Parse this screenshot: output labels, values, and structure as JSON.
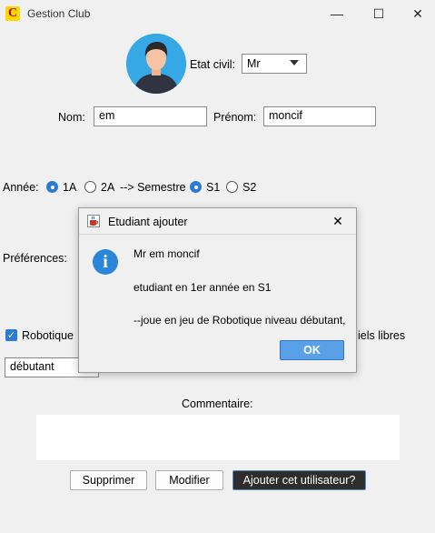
{
  "window": {
    "title": "Gestion Club",
    "app_icon_letter": "C",
    "minimize_glyph": "—",
    "maximize_glyph": "☐",
    "close_glyph": "✕"
  },
  "form": {
    "etat_civil_label": "Etat civil:",
    "etat_civil_value": "Mr",
    "nom_label": "Nom:",
    "nom_value": "em",
    "prenom_label": "Prénom:",
    "prenom_value": "moncif",
    "annee_label": "Année:",
    "annee_options": [
      "1A",
      "2A"
    ],
    "semestre_label": "--> Semestre",
    "semestre_options": [
      "S1",
      "S2"
    ],
    "preferences_label": "Préférences:",
    "robotique_label": "Robotique",
    "logiciels_partial": "iels libres",
    "niveau_value": "débutant",
    "commentaire_label": "Commentaire:",
    "commentaire_value": ""
  },
  "buttons": {
    "supprimer": "Supprimer",
    "modifier": "Modifier",
    "ajouter": "Ajouter cet utilisateur?"
  },
  "dialog": {
    "title": "Etudiant ajouter",
    "close_glyph": "✕",
    "info_glyph": "i",
    "line1": "Mr em moncif",
    "line2": "etudiant en 1er année en S1",
    "line3": "--joue en jeu de Robotique niveau débutant,",
    "ok": "OK"
  },
  "colors": {
    "accent": "#2b7bd6",
    "avatar_bg": "#37a8e6",
    "ok_button": "#5aa0e6",
    "dark_button": "#2d2d2d"
  },
  "icons": [
    "app-icon",
    "avatar-icon",
    "dropdown-arrow-icon",
    "info-icon",
    "java-cup-icon",
    "check-icon"
  ]
}
